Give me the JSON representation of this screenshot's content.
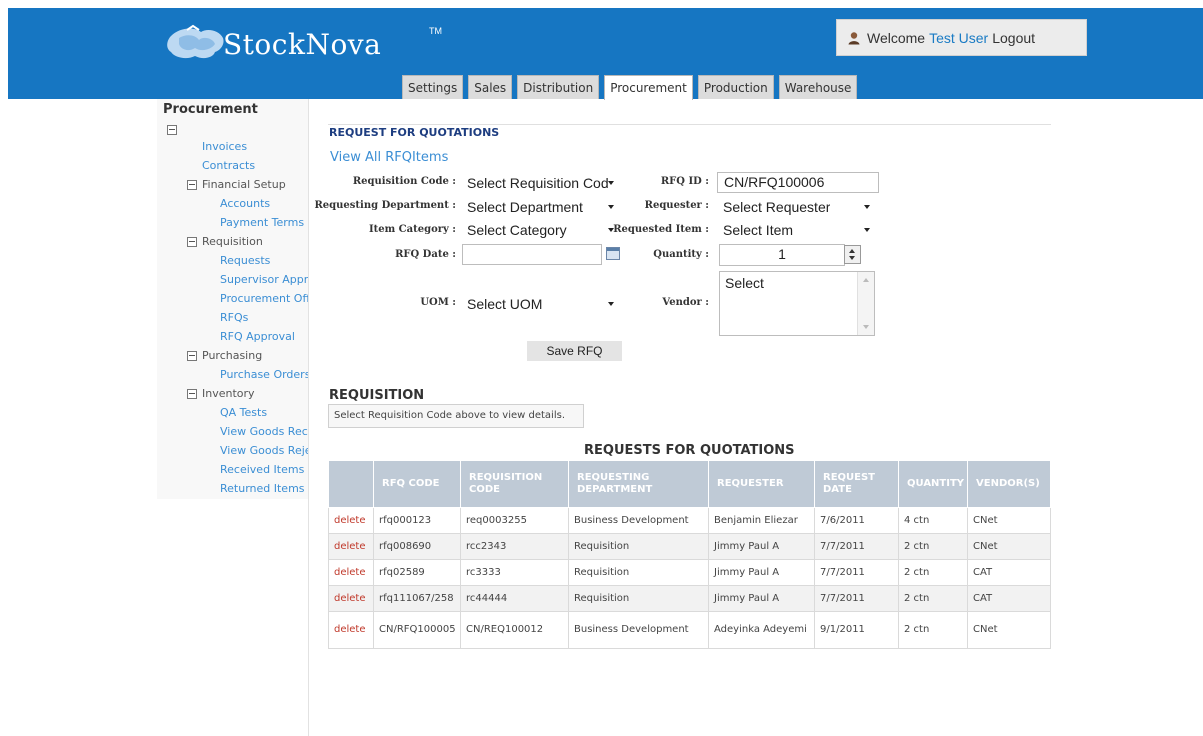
{
  "app": {
    "name": "StockNova",
    "trademark": "TM"
  },
  "header": {
    "welcome_text": "Welcome",
    "user_name": "Test User",
    "logout_label": "Logout"
  },
  "tabs": [
    {
      "label": "Settings"
    },
    {
      "label": "Sales"
    },
    {
      "label": "Distribution"
    },
    {
      "label": "Procurement",
      "active": true
    },
    {
      "label": "Production"
    },
    {
      "label": "Warehouse"
    }
  ],
  "sidebar": {
    "title": "Procurement",
    "items": [
      {
        "label": "Invoices"
      },
      {
        "label": "Contracts"
      },
      {
        "label": "Financial Setup"
      },
      {
        "label": "Accounts"
      },
      {
        "label": "Payment Terms"
      },
      {
        "label": "Requisition"
      },
      {
        "label": "Requests"
      },
      {
        "label": "Supervisor Appro"
      },
      {
        "label": "Procurement Offi"
      },
      {
        "label": "RFQs"
      },
      {
        "label": "RFQ Approval"
      },
      {
        "label": "Purchasing"
      },
      {
        "label": "Purchase Orders"
      },
      {
        "label": "Inventory"
      },
      {
        "label": "QA Tests"
      },
      {
        "label": "View Goods Rece"
      },
      {
        "label": "View Goods Reje"
      },
      {
        "label": "Received Items"
      },
      {
        "label": "Returned Items"
      }
    ]
  },
  "form": {
    "section_title": "REQUEST FOR QUOTATIONS",
    "view_all_link": "View All RFQItems",
    "requisition_code": {
      "label": "Requisition Code :",
      "value": "Select Requisition Cod"
    },
    "rfq_id": {
      "label": "RFQ ID :",
      "value": "CN/RFQ100006"
    },
    "requesting_department": {
      "label": "Requesting Department :",
      "value": "Select Department"
    },
    "requester": {
      "label": "Requester :",
      "value": "Select Requester"
    },
    "item_category": {
      "label": "Item Category :",
      "value": "Select Category"
    },
    "requested_item": {
      "label": "Requested Item :",
      "value": "Select Item"
    },
    "rfq_date": {
      "label": "RFQ Date :",
      "value": ""
    },
    "quantity": {
      "label": "Quantity :",
      "value": "1"
    },
    "uom": {
      "label": "UOM :",
      "value": "Select UOM"
    },
    "vendor": {
      "label": "Vendor :",
      "value": "Select"
    },
    "save_button": "Save RFQ"
  },
  "requisition": {
    "title": "REQUISITION",
    "hint": "Select Requisition Code above to view details."
  },
  "table": {
    "title": "REQUESTS FOR QUOTATIONS",
    "headers": [
      "",
      "RFQ CODE",
      "REQUISITION CODE",
      "REQUESTING DEPARTMENT",
      "REQUESTER",
      "REQUEST DATE",
      "QUANTITY",
      "VENDOR(S)"
    ],
    "rows": [
      {
        "action": "delete",
        "rfq_code": "rfq000123",
        "requisition_code": "req0003255",
        "department": "Business Development",
        "requester": "Benjamin Eliezar",
        "date": "7/6/2011",
        "quantity": "4 ctn",
        "vendor": "CNet"
      },
      {
        "action": "delete",
        "rfq_code": "rfq008690",
        "requisition_code": "rcc2343",
        "department": "Requisition",
        "requester": "Jimmy Paul A",
        "date": "7/7/2011",
        "quantity": "2 ctn",
        "vendor": "CNet"
      },
      {
        "action": "delete",
        "rfq_code": "rfq02589",
        "requisition_code": "rc3333",
        "department": "Requisition",
        "requester": "Jimmy Paul A",
        "date": "7/7/2011",
        "quantity": "2 ctn",
        "vendor": "CAT"
      },
      {
        "action": "delete",
        "rfq_code": "rfq111067/258",
        "requisition_code": "rc44444",
        "department": "Requisition",
        "requester": "Jimmy Paul A",
        "date": "7/7/2011",
        "quantity": "2 ctn",
        "vendor": "CAT"
      },
      {
        "action": "delete",
        "rfq_code": "CN/RFQ100005",
        "requisition_code": "CN/REQ100012",
        "department": "Business Development",
        "requester": "Adeyinka Adeyemi",
        "date": "9/1/2011",
        "quantity": "2 ctn",
        "vendor": "CNet"
      }
    ]
  },
  "colors": {
    "header_bg": "#1676c2",
    "link": "#3b8ed4",
    "delete": "#c0392b",
    "table_header": "#bfcad6"
  },
  "icons": [
    "logo-puzzle-icon",
    "user-icon",
    "tree-collapse-icon",
    "calendar-icon",
    "spinner-up-icon",
    "spinner-down-icon",
    "dropdown-arrow-icon"
  ]
}
